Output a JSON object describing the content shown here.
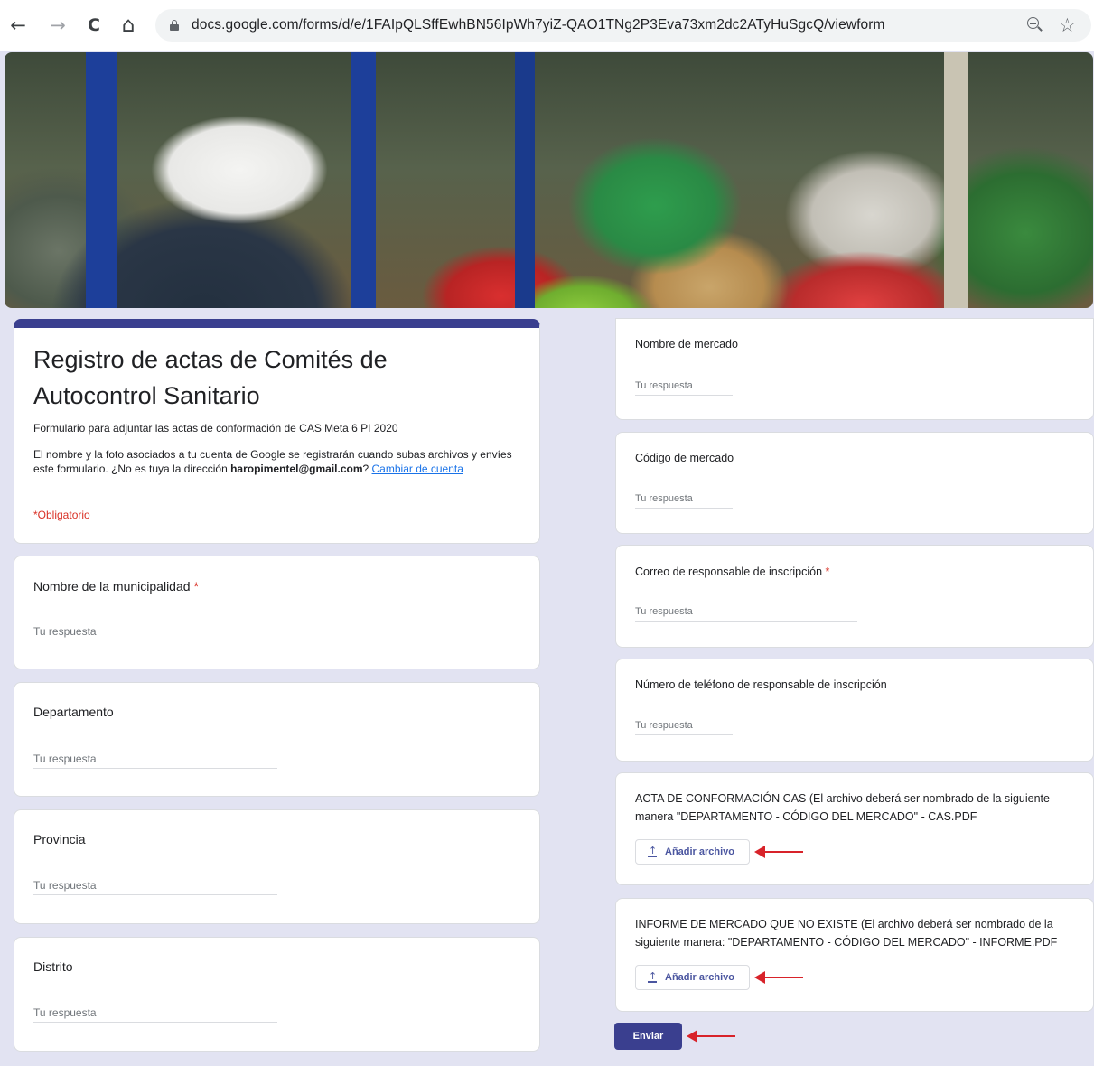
{
  "browser": {
    "url": "docs.google.com/forms/d/e/1FAIpQLSffEwhBN56IpWh7yiZ-QAO1TNg2P3Eva73xm2dc2ATyHuSgcQ/viewform",
    "icons": [
      "back-arrow-icon",
      "forward-arrow-icon",
      "reload-icon",
      "home-icon",
      "lock-icon",
      "zoom-out-icon",
      "bookmark-star-icon"
    ],
    "back_glyph": "←",
    "forward_glyph": "→",
    "reload_glyph": "C",
    "home_glyph": "⌂",
    "star_glyph": "☆"
  },
  "form": {
    "title": "Registro de actas de Comités de Autocontrol Sanitario",
    "description": "Formulario para adjuntar las actas de conformación de CAS Meta 6 PI 2020",
    "account_note_prefix": "El nombre y la foto asociados a tu cuenta de Google se registrarán cuando subas archivos y envíes este formulario. ¿No es tuya la dirección ",
    "account_email": "haropimentel@gmail.com",
    "account_note_suffix": "? ",
    "change_account_link": "Cambiar de cuenta",
    "required_note": "*Obligatorio",
    "accent_color": "#3a3f8f",
    "background_color": "#e2e3f2",
    "required_color": "#d93025"
  },
  "questions_left": [
    {
      "label": "Nombre de la municipalidad",
      "required_mark": "*",
      "placeholder": "Tu respuesta"
    },
    {
      "label": "Departamento",
      "placeholder": "Tu respuesta"
    },
    {
      "label": "Provincia",
      "placeholder": "Tu respuesta"
    },
    {
      "label": "Distrito",
      "placeholder": "Tu respuesta"
    }
  ],
  "questions_right": [
    {
      "label": "Nombre de mercado",
      "placeholder": "Tu respuesta"
    },
    {
      "label": "Código de mercado",
      "placeholder": "Tu respuesta"
    },
    {
      "label": "Correo de responsable de inscripción",
      "required_mark": "*",
      "placeholder": "Tu respuesta"
    },
    {
      "label": "Número de teléfono de responsable de inscripción",
      "placeholder": "Tu respuesta"
    }
  ],
  "uploads": [
    {
      "label": "ACTA DE CONFORMACIÓN CAS (El archivo deberá ser nombrado de la siguiente manera \"DEPARTAMENTO - CÓDIGO DEL MERCADO\" - CAS.PDF",
      "button": "Añadir archivo",
      "icon": "upload-icon"
    },
    {
      "label": "INFORME DE MERCADO QUE NO EXISTE (El archivo deberá ser nombrado de la siguiente manera: \"DEPARTAMENTO - CÓDIGO DEL MERCADO\" - INFORME.PDF",
      "button": "Añadir archivo",
      "icon": "upload-icon"
    }
  ],
  "submit_label": "Enviar",
  "annotations": {
    "arrow_color": "#d8232a",
    "icon": "red-arrow-annotation"
  }
}
